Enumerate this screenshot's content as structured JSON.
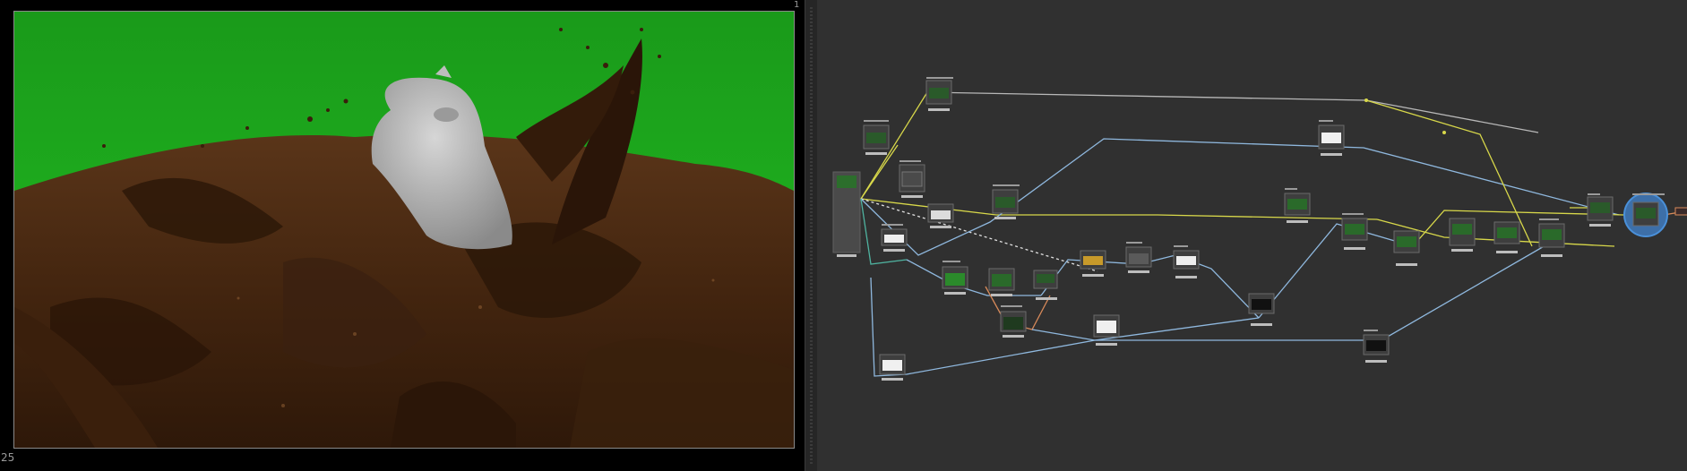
{
  "viewer": {
    "frame_number": "25",
    "corner_mark": "1"
  },
  "node_graph": {
    "accent": "#d8d84a",
    "link_blue": "#8fb8de",
    "link_orange": "#d88a5a",
    "link_teal": "#4fb3a0",
    "selected_ring": "#4a90d9"
  },
  "colors": {
    "greenscreen": "#1fbf1f",
    "mud": "#4a2a12",
    "creature": "#b9b9b9",
    "panel": "#303030"
  }
}
